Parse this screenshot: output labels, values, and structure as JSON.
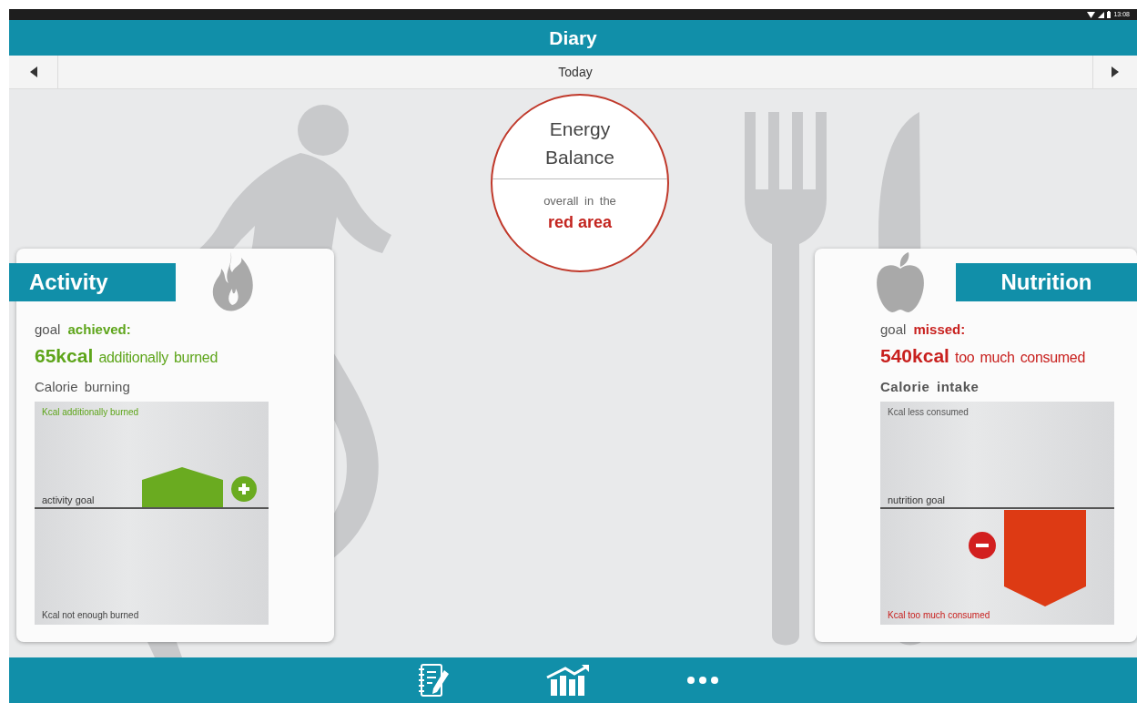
{
  "status_bar": {
    "time": "13:08"
  },
  "header": {
    "title": "Diary"
  },
  "date_nav": {
    "label": "Today"
  },
  "energy_balance": {
    "title": "Energy Balance",
    "caption": "overall in the",
    "status": "red area"
  },
  "cards": [
    {
      "kind": "activity",
      "title": "Activity",
      "goal": "goal **achieved:**",
      "result": "**65kcal** additionally burned",
      "chart_title": "Calorie burning",
      "chart_top_label": "Kcal additionally burned",
      "goal_line_label": "activity goal",
      "chart_bottom_label": "Kcal not enough burned"
    },
    {
      "kind": "nutrition",
      "title": "Nutrition",
      "goal": "goal **missed:**",
      "result": "**540kcal** too much consumed",
      "chart_title": "Calorie intake",
      "chart_top_label": "Kcal less consumed",
      "goal_line_label": "nutrition goal",
      "chart_bottom_label": "Kcal too much consumed"
    }
  ],
  "bottom_nav": [
    {
      "kind": "diary"
    },
    {
      "kind": "statistics"
    },
    {
      "kind": "more"
    }
  ]
}
